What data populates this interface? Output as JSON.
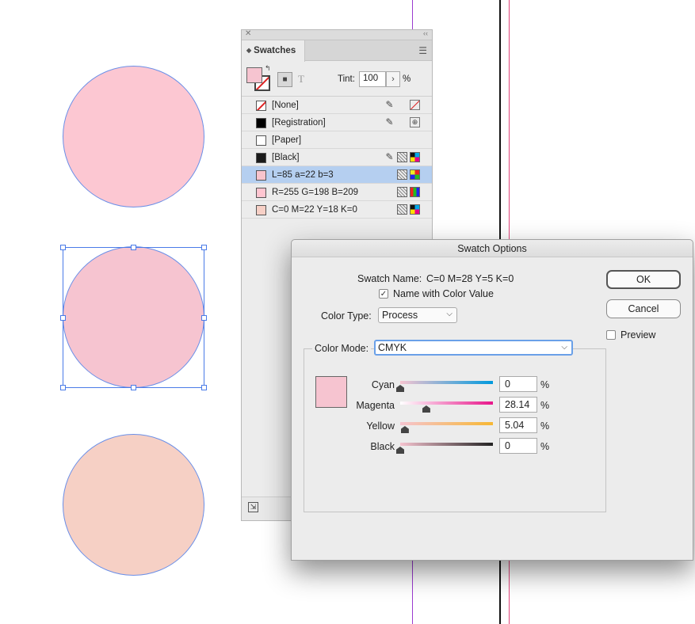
{
  "canvas": {
    "colors": {
      "circle_top": "#fcc7d2",
      "circle_middle": "#f6c4d0",
      "circle_bottom": "#f6d0c5",
      "selection": "#4a7be8"
    }
  },
  "swatches_panel": {
    "tab_title": "Swatches",
    "tint_label": "Tint:",
    "tint_value": "100",
    "tint_unit": "%",
    "swatches": [
      {
        "name": "[None]",
        "color": "none",
        "selected": false
      },
      {
        "name": "[Registration]",
        "color": "#000000",
        "selected": false
      },
      {
        "name": "[Paper]",
        "color": "#ffffff",
        "selected": false
      },
      {
        "name": "[Black]",
        "color": "#1a1a1a",
        "selected": false
      },
      {
        "name": "L=85 a=22 b=3",
        "color": "#f8c4cc",
        "selected": true
      },
      {
        "name": "R=255 G=198 B=209",
        "color": "#ffc6d1",
        "selected": false
      },
      {
        "name": "C=0 M=22 Y=18 K=0",
        "color": "#f7d0c6",
        "selected": false
      }
    ]
  },
  "dialog": {
    "title": "Swatch Options",
    "swatch_name_label": "Swatch Name:",
    "swatch_name_value": "C=0 M=28 Y=5 K=0",
    "name_with_color_value_label": "Name with Color Value",
    "name_with_color_value_checked": true,
    "color_type_label": "Color Type:",
    "color_type_value": "Process",
    "color_mode_label": "Color Mode:",
    "color_mode_value": "CMYK",
    "ok_label": "OK",
    "cancel_label": "Cancel",
    "preview_label": "Preview",
    "preview_checked": false,
    "preview_color": "#f6c4d0",
    "sliders": [
      {
        "label": "Cyan",
        "value": "0",
        "unit": "%",
        "level": 0
      },
      {
        "label": "Magenta",
        "value": "28.14",
        "unit": "%",
        "level": 0.2814
      },
      {
        "label": "Yellow",
        "value": "5.04",
        "unit": "%",
        "level": 0.0504
      },
      {
        "label": "Black",
        "value": "0",
        "unit": "%",
        "level": 0
      }
    ]
  }
}
